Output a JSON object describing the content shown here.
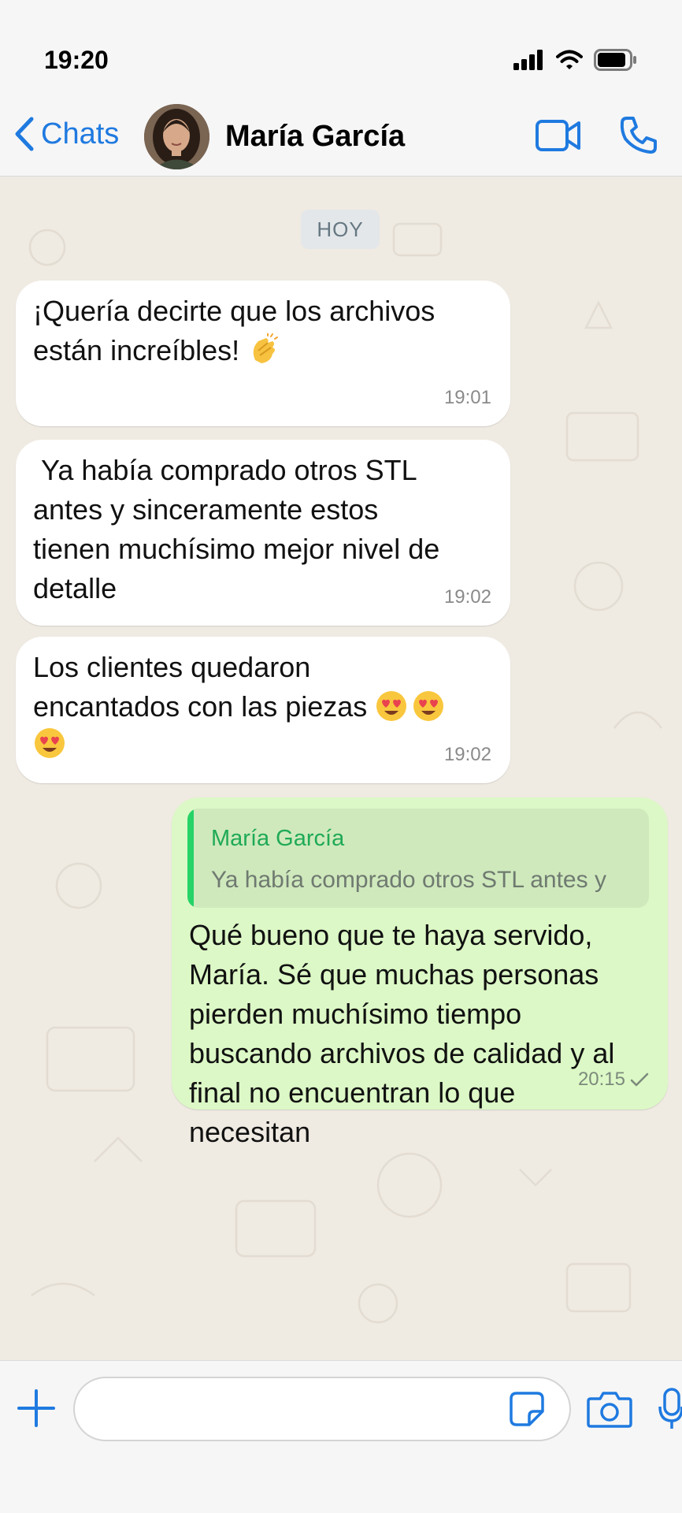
{
  "status_bar": {
    "time": "19:20"
  },
  "header": {
    "back_label": "Chats",
    "contact_name": "María García"
  },
  "chat": {
    "day_label": "HOY",
    "incoming": [
      {
        "text": "¡Quería decirte que los archivos\nestán increíbles! ",
        "emojis": [
          "clapping-hands-emoji"
        ],
        "time": "19:01"
      },
      {
        "text": " Ya había comprado otros STL\nantes y sinceramente estos\ntienen muchísimo mejor nivel de\ndetalle",
        "emojis": [],
        "time": "19:02"
      },
      {
        "text": "Los clientes quedaron\nencantados con las piezas ",
        "emojis": [
          "heart-eyes-emoji",
          "heart-eyes-emoji",
          "heart-eyes-emoji"
        ],
        "time": "19:02"
      }
    ],
    "outgoing": {
      "quote_author": "María García",
      "quote_text": "Ya había comprado otros STL antes y",
      "text": "Qué bueno que te haya servido,\nMaría. Sé que muchas personas\npierden muchísimo tiempo\nbuscando archivos de calidad y al\nfinal no encuentran lo que\nnecesitan",
      "time": "20:15",
      "status_icon": "single-check-icon"
    }
  },
  "input": {
    "placeholder": ""
  },
  "colors": {
    "accent_blue": "#1f7ae0",
    "outgoing_bubble": "#dcf8c6",
    "quote_green": "#25d366",
    "chat_background": "#efeae2"
  }
}
